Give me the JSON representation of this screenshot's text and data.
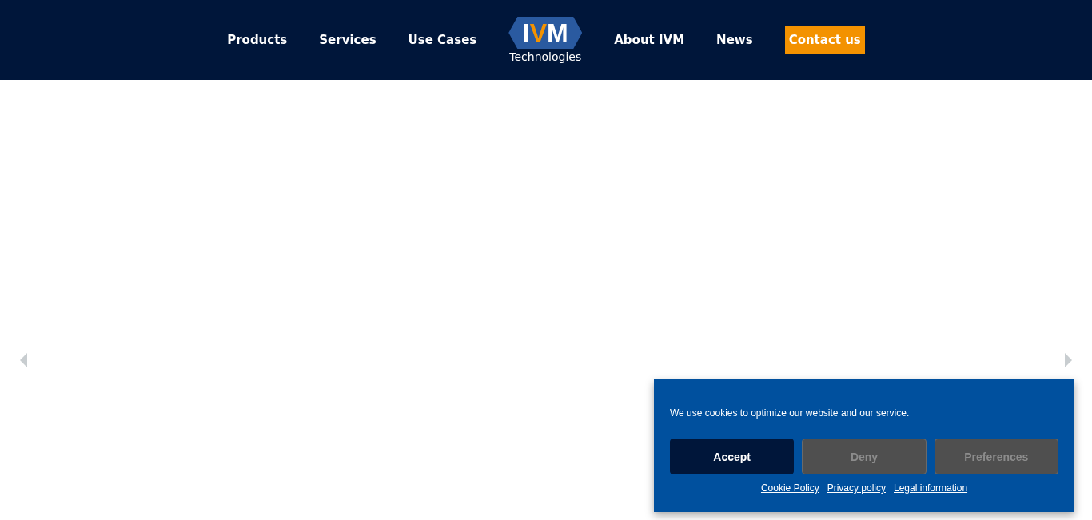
{
  "header": {
    "nav_left": [
      {
        "label": "Products",
        "kind": "link"
      },
      {
        "label": "Services",
        "kind": "link"
      },
      {
        "label": "Use Cases",
        "kind": "link"
      }
    ],
    "logo": {
      "letters": [
        {
          "text": "I",
          "color": "#ffffff"
        },
        {
          "text": "V",
          "color": "#f39200"
        },
        {
          "text": "M",
          "color": "#ffffff"
        }
      ],
      "subtitle": "Technologies"
    },
    "nav_right": [
      {
        "label": "About IVM",
        "kind": "link"
      },
      {
        "label": "News",
        "kind": "link"
      },
      {
        "label": "Contact us",
        "kind": "cta"
      }
    ]
  },
  "cookie_banner": {
    "message": "We use cookies to optimize our website and our service.",
    "buttons": [
      {
        "label": "Accept",
        "kind": "primary"
      },
      {
        "label": "Deny",
        "kind": "secondary"
      },
      {
        "label": "Preferences",
        "kind": "secondary"
      }
    ],
    "links": [
      "Cookie Policy",
      "Privacy policy",
      "Legal information"
    ]
  }
}
